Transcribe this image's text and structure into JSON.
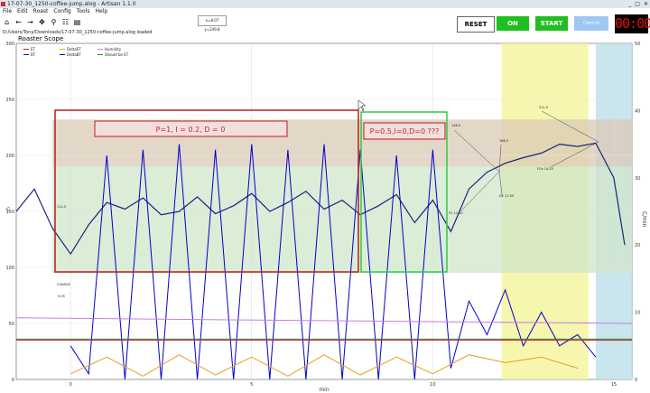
{
  "window": {
    "title": "17-07-30_1250-coffee-jump.alog - Artisan 1.1.0",
    "controls": [
      "_",
      "□",
      "✕"
    ]
  },
  "menu": [
    "File",
    "Edit",
    "Roast",
    "Config",
    "Tools",
    "Help"
  ],
  "toolbar": {
    "icons": [
      "home-icon",
      "back-icon",
      "forward-icon",
      "pan-icon",
      "zoom-icon",
      "settings-icon",
      "save-icon"
    ],
    "readout": "x=8:07 y=249.8"
  },
  "filepath": "D:/Users/Tony/Downloads/17-07-30_1250-coffee-jump.alog  loaded",
  "buttons": {
    "reset": "RESET",
    "on": "ON",
    "start": "START",
    "control": "Control"
  },
  "timer": "00:00",
  "chart": {
    "title": "Roaster Scope",
    "ylabel": "C",
    "y2label": "C/min",
    "xlabel": "min",
    "yticks": [
      "0",
      "50",
      "100",
      "150",
      "200",
      "250",
      "300"
    ],
    "y2ticks": [
      "0",
      "10",
      "20",
      "30",
      "40",
      "50"
    ],
    "xticks": [
      "0",
      "5",
      "10",
      "15"
    ],
    "legend": [
      "ET",
      "BT",
      "DeltaET",
      "DeltaBT",
      "Humidity",
      "Should be ET"
    ],
    "annotations": {
      "box1": "P=1, I = 0.2, D = 0",
      "box2": "P=0.5,I=0,D=0 ???",
      "charge": "CHARGE",
      "small": [
        "111.5",
        "0:05",
        "148.0",
        "166.3",
        "FC 11:50",
        "DE 11:59",
        "FCe 14:20",
        "211.5"
      ]
    }
  },
  "chart_data": {
    "type": "line",
    "title": "Roaster Scope",
    "xlabel": "min",
    "ylabel": "C",
    "y2label": "C/min",
    "xlim": [
      -1.5,
      15.5
    ],
    "ylim": [
      0,
      300
    ],
    "y2lim": [
      0,
      50
    ],
    "series": [
      {
        "name": "BT",
        "color": "#1a237e",
        "x": [
          -1.5,
          -1,
          -0.5,
          0,
          0.5,
          1,
          1.5,
          2,
          2.5,
          3,
          3.5,
          4,
          4.5,
          5,
          5.5,
          6,
          6.5,
          7,
          7.5,
          8,
          8.5,
          9,
          9.5,
          10,
          10.5,
          11,
          11.5,
          12,
          12.5,
          13,
          13.5,
          14,
          14.5,
          15,
          15.3
        ],
        "y": [
          150,
          170,
          135,
          112,
          138,
          158,
          152,
          162,
          147,
          150,
          163,
          148,
          155,
          166,
          150,
          158,
          168,
          152,
          160,
          147,
          155,
          165,
          140,
          160,
          132,
          170,
          185,
          193,
          198,
          202,
          210,
          208,
          211,
          180,
          120
        ]
      },
      {
        "name": "DeltaBT",
        "color": "#0000cc",
        "x": [
          0,
          0.5,
          1,
          1.5,
          2,
          2.5,
          3,
          3.5,
          4,
          4.5,
          5,
          5.5,
          6,
          6.5,
          7,
          7.5,
          8,
          8.5,
          9,
          9.5,
          10,
          10.5,
          11,
          11.5,
          12,
          12.5,
          13,
          13.5,
          14,
          14.5
        ],
        "y": [
          30,
          5,
          200,
          0,
          205,
          0,
          210,
          0,
          205,
          0,
          210,
          0,
          205,
          0,
          210,
          0,
          205,
          0,
          200,
          0,
          205,
          10,
          70,
          40,
          80,
          30,
          60,
          30,
          40,
          20
        ]
      },
      {
        "name": "DeltaET",
        "color": "#e6a01e",
        "x": [
          0,
          1,
          2,
          3,
          4,
          5,
          6,
          7,
          8,
          9,
          10,
          11,
          12,
          13,
          14
        ],
        "y": [
          5,
          20,
          3,
          22,
          4,
          20,
          3,
          22,
          4,
          20,
          5,
          22,
          15,
          20,
          10
        ]
      },
      {
        "name": "Humidity",
        "color": "#c080e0",
        "x": [
          -1.5,
          15.5
        ],
        "y": [
          55,
          50
        ]
      },
      {
        "name": "ET",
        "color": "#c62828",
        "x": [
          -1.5,
          15.5
        ],
        "y": [
          35,
          35
        ]
      },
      {
        "name": "Should be ET",
        "color": "#2e7d32",
        "x": [
          -1.5,
          15.5
        ],
        "y": [
          36,
          36
        ]
      }
    ],
    "bands": [
      {
        "from": 190,
        "to": 232,
        "color": "#d9c9b6"
      },
      {
        "from": 95,
        "to": 190,
        "color": "#cfe5c9"
      }
    ],
    "phases": [
      {
        "from": 11.9,
        "to": 14.3,
        "color": "#f5f5a0"
      },
      {
        "from": 14.5,
        "to": 15.5,
        "color": "#bfe0ea"
      }
    ],
    "grid": true,
    "legend_position": "top-left"
  }
}
